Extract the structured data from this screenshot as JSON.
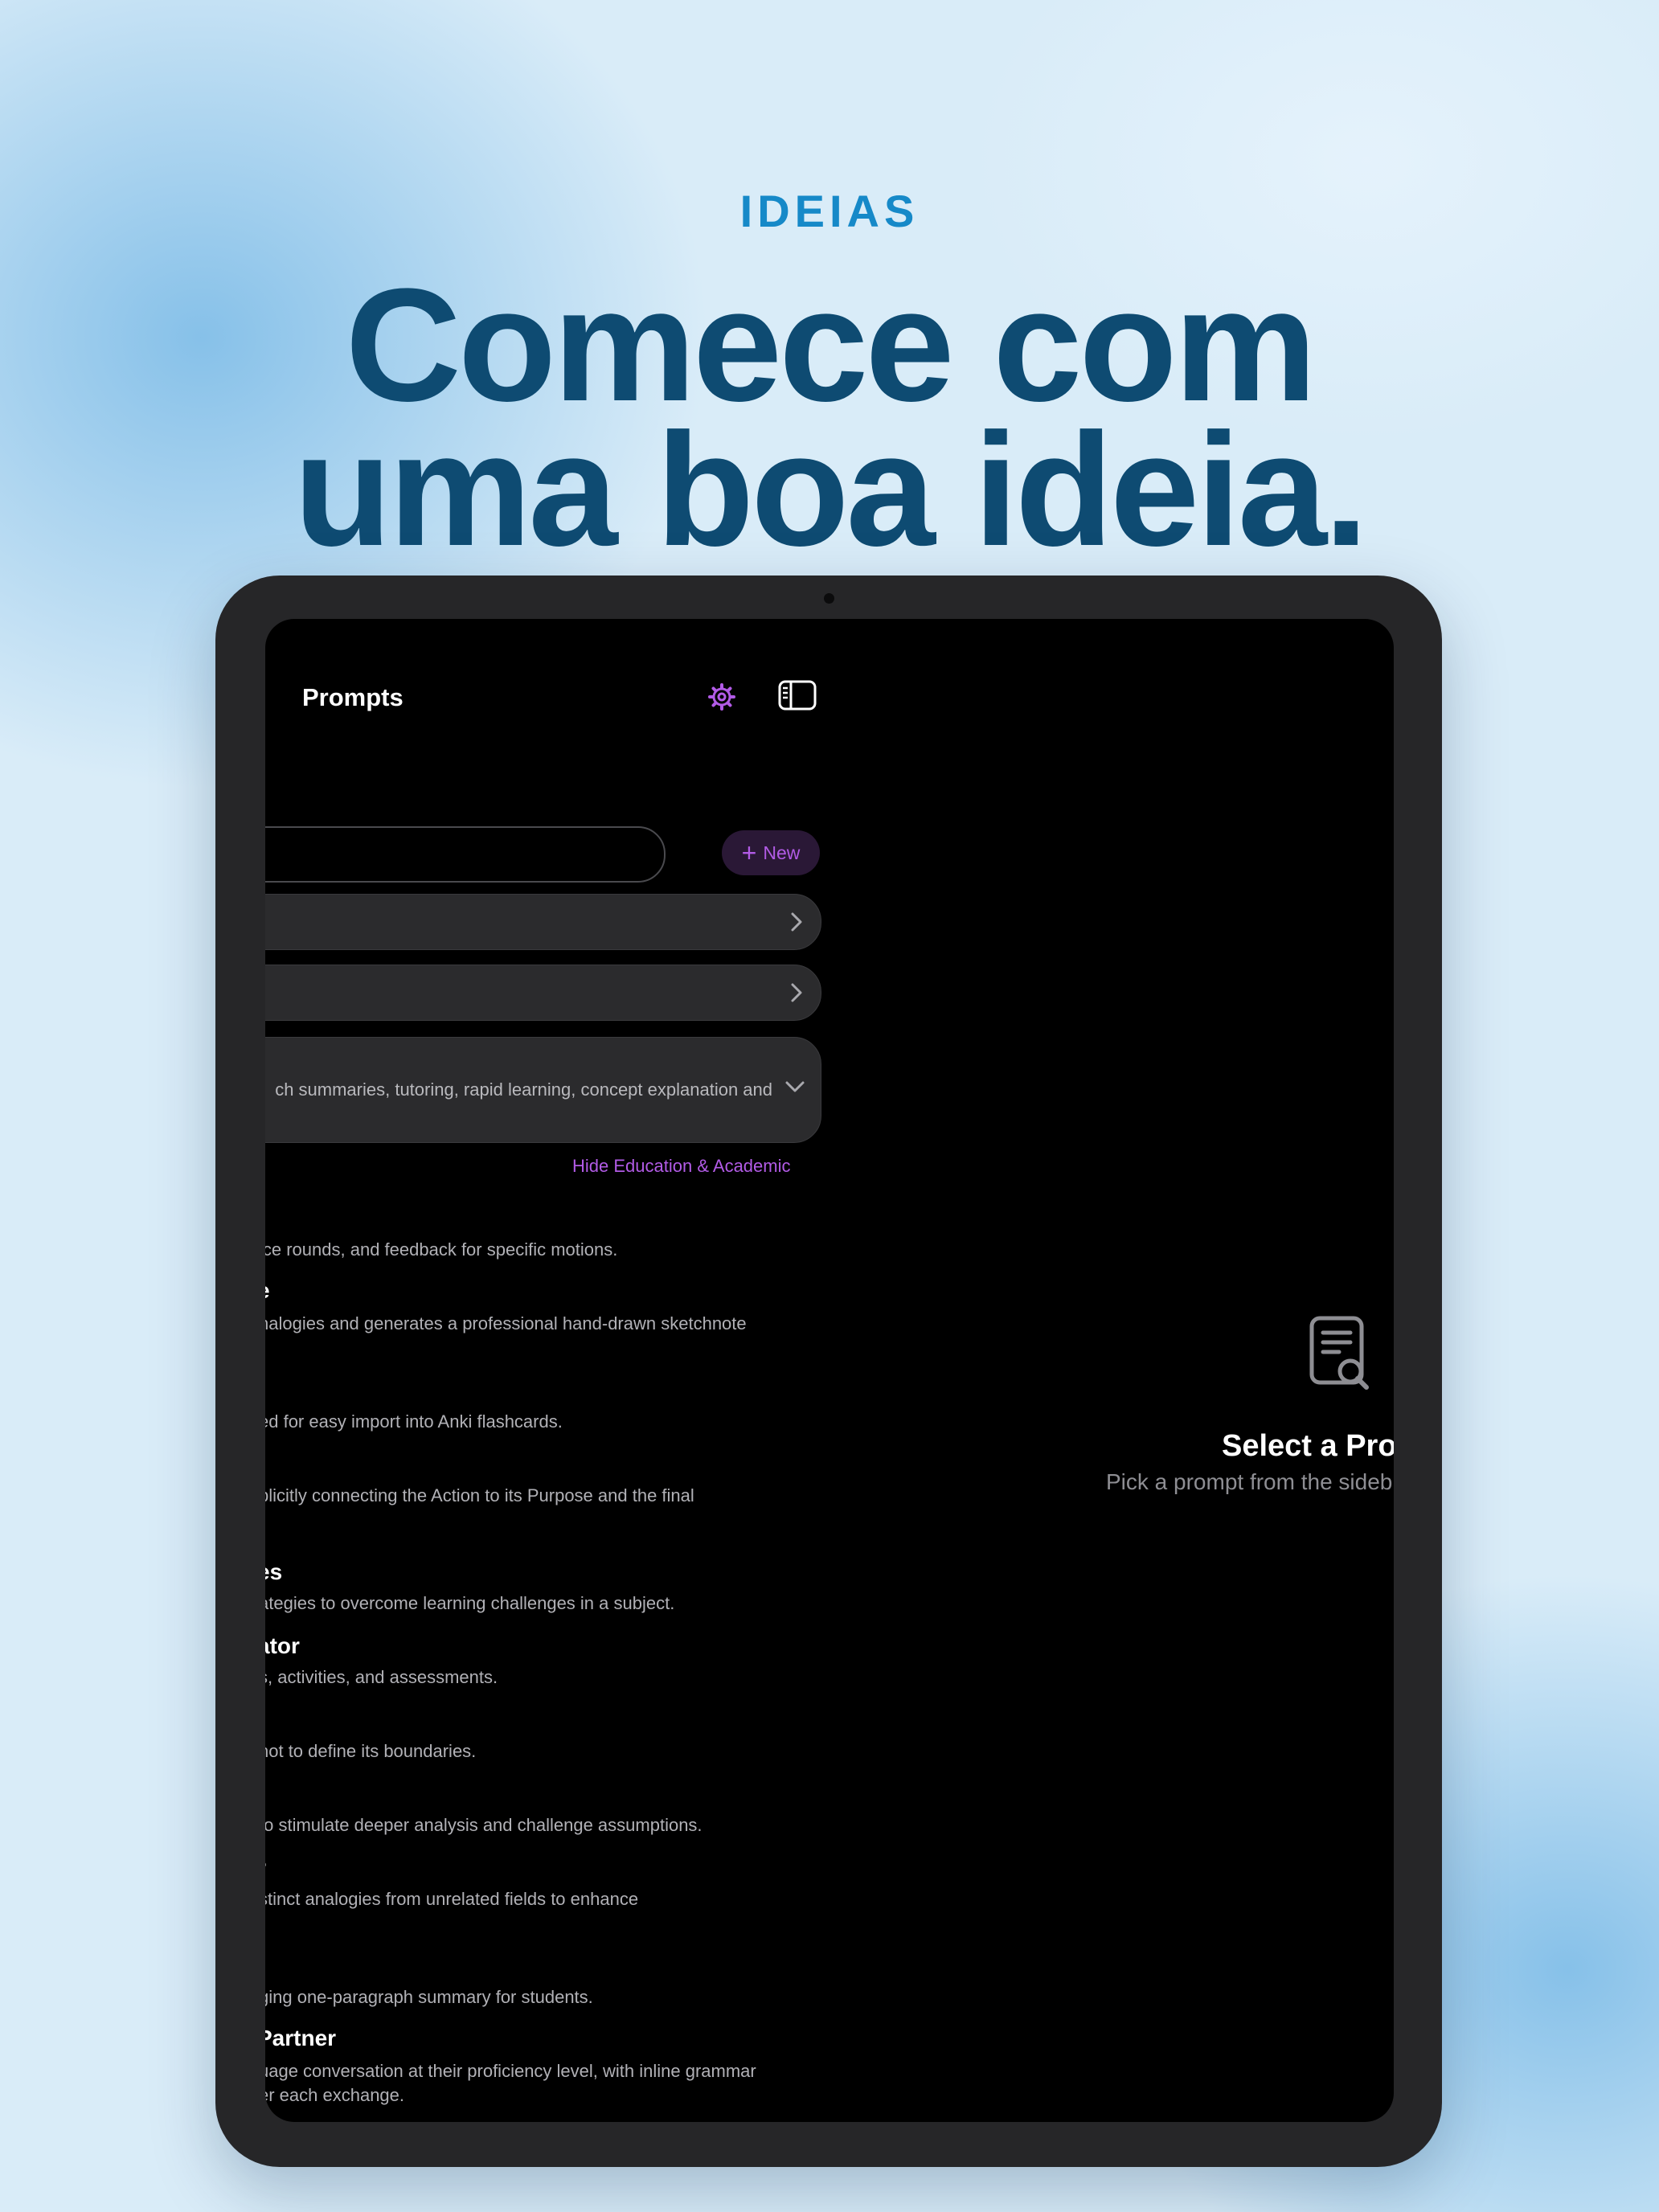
{
  "marketing": {
    "eyebrow": "IDEIAS",
    "headline_line1": "Comece com",
    "headline_line2": "uma boa ideia."
  },
  "sidebar": {
    "title": "Prompts",
    "new_button": "New",
    "expanded_category_desc": "ch summaries, tutoring, rapid learning, concept explanation and",
    "hide_link": "Hide Education & Academic",
    "items": [
      {
        "title": "",
        "desc": "ice rounds, and feedback for specific motions."
      },
      {
        "title": "e",
        "desc": "nalogies and generates a professional hand-drawn sketchnote"
      },
      {
        "title": "",
        "desc": "ed for easy import into Anki flashcards."
      },
      {
        "title": "",
        "desc": "plicitly connecting the Action to its Purpose and the final"
      },
      {
        "title": "es",
        "desc": "ategies to overcome learning challenges in a subject."
      },
      {
        "title": "ator",
        "desc": "s, activities, and assessments."
      },
      {
        "title": "",
        "desc": "not to define its boundaries."
      },
      {
        "title": "",
        "desc": "to stimulate deeper analysis and challenge assumptions."
      },
      {
        "title": "r",
        "desc": "stinct analogies from unrelated fields to enhance"
      },
      {
        "title": "",
        "desc": "ging one-paragraph summary for students."
      },
      {
        "title": "Partner",
        "desc": "uage conversation at their proficiency level, with inline grammar",
        "desc2": "er each exchange."
      }
    ]
  },
  "detail": {
    "title": "Select a Pro",
    "subtitle": "Pick a prompt from the sideb"
  },
  "colors": {
    "accent": "#b25be6",
    "headline": "#0e4b72",
    "eyebrow": "#1689c8"
  }
}
